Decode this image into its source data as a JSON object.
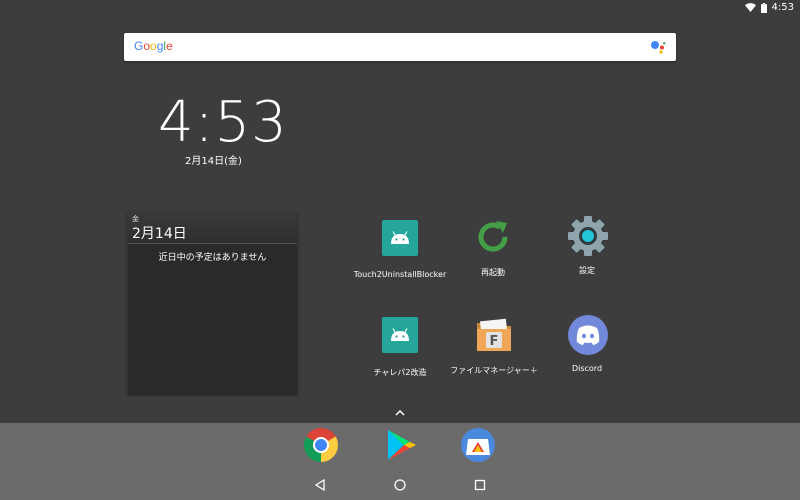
{
  "status": {
    "time": "4:53"
  },
  "search": {
    "logo_text": "Google"
  },
  "clock": {
    "time": "4:53",
    "date": "2月14日(金)"
  },
  "calendar": {
    "weekday": "金",
    "date": "2月14日",
    "empty_message": "近日中の予定はありません"
  },
  "apps": [
    {
      "label": "Touch2UninstallBlocker",
      "icon": "android-icon"
    },
    {
      "label": "再起動",
      "icon": "restart-icon"
    },
    {
      "label": "設定",
      "icon": "settings-gear-icon"
    },
    {
      "label": "チャレパ2改造",
      "icon": "android-icon"
    },
    {
      "label": "ファイルマネージャー＋",
      "icon": "folder-icon"
    },
    {
      "label": "Discord",
      "icon": "discord-icon"
    }
  ],
  "dock": {
    "apps": [
      "chrome-icon",
      "play-store-icon",
      "app-store-icon"
    ]
  },
  "nav": {
    "buttons": [
      "back-icon",
      "home-icon",
      "recents-icon"
    ]
  },
  "colors": {
    "background": "#3d3d3d",
    "dock": "#6b6b6b",
    "android_tile": "#26a69a",
    "restart_green": "#43a047",
    "discord_blurple": "#7289da"
  }
}
